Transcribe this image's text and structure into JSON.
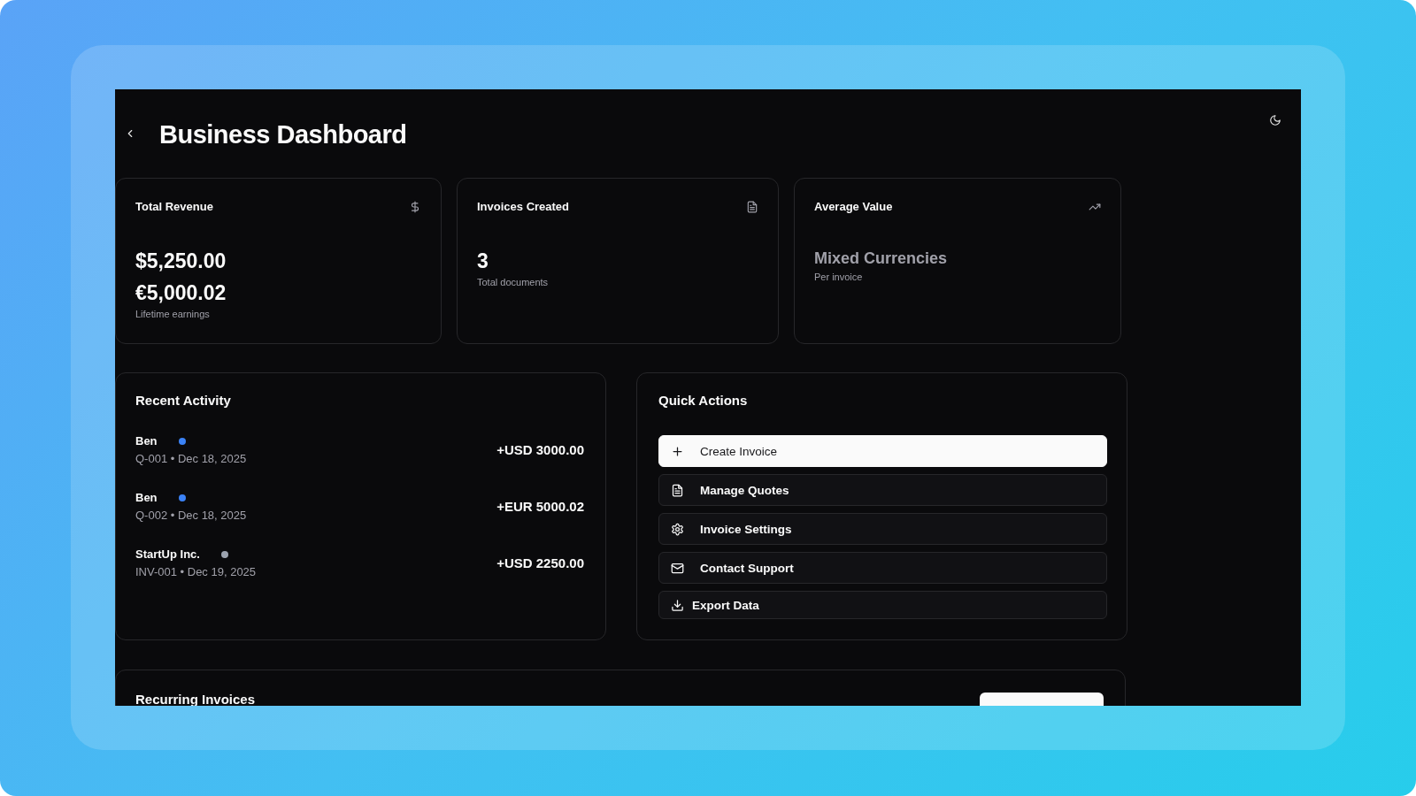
{
  "header": {
    "title": "Business Dashboard"
  },
  "stats": [
    {
      "kind": "revenue",
      "title": "Total Revenue",
      "values": [
        "$5,250.00",
        "€5,000.02"
      ],
      "muted": false,
      "caption": "Lifetime earnings"
    },
    {
      "kind": "documents",
      "title": "Invoices Created",
      "values": [
        "3"
      ],
      "muted": false,
      "caption": "Total documents"
    },
    {
      "kind": "trend",
      "title": "Average Value",
      "values": [
        "Mixed Currencies"
      ],
      "muted": true,
      "caption": "Per invoice"
    }
  ],
  "recent_activity": {
    "title": "Recent Activity",
    "items": [
      {
        "name": "Ben",
        "color": "#3b82f6",
        "detail": "Q-001 • Dec 18, 2025",
        "amount": "+USD 3000.00"
      },
      {
        "name": "Ben",
        "color": "#3b82f6",
        "detail": "Q-002 • Dec 18, 2025",
        "amount": "+EUR 5000.02"
      },
      {
        "name": "StartUp Inc.",
        "color": "#9ca3af",
        "detail": "INV-001 • Dec 19, 2025",
        "amount": "+USD 2250.00"
      }
    ]
  },
  "quick_actions": {
    "title": "Quick Actions",
    "actions": [
      {
        "kind": "plus",
        "label": "Create Invoice",
        "selected": true
      },
      {
        "kind": "document",
        "label": "Manage Quotes",
        "selected": false
      },
      {
        "kind": "gear",
        "label": "Invoice Settings",
        "selected": false
      },
      {
        "kind": "mail",
        "label": "Contact Support",
        "selected": false
      },
      {
        "kind": "download",
        "label": "Export Data",
        "selected": false
      }
    ]
  },
  "recurring_invoices": {
    "title": "Recurring Invoices"
  }
}
